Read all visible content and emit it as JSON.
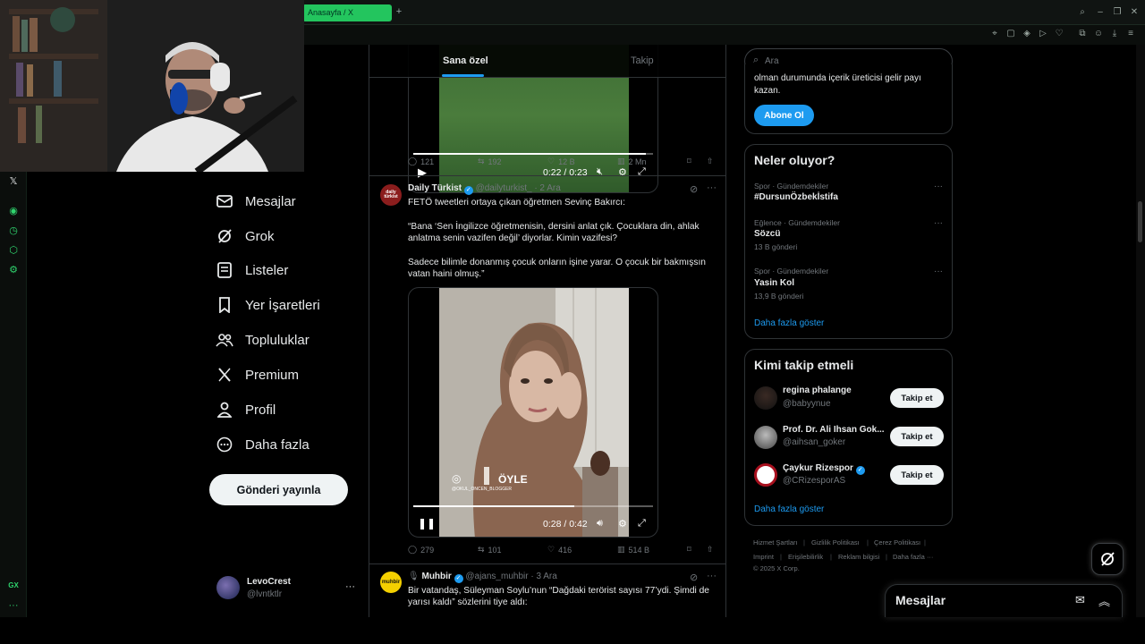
{
  "browser": {
    "tab_title": "Anasayfa / X",
    "new_tab": "+"
  },
  "gx_rail": {
    "bottom_label": "GX",
    "more": "···"
  },
  "nav": {
    "items": [
      {
        "label": "Mesajlar",
        "icon": "mail-icon"
      },
      {
        "label": "Grok",
        "icon": "grok-icon"
      },
      {
        "label": "Listeler",
        "icon": "list-icon"
      },
      {
        "label": "Yer İşaretleri",
        "icon": "bookmark-icon"
      },
      {
        "label": "Topluluklar",
        "icon": "communities-icon"
      },
      {
        "label": "Premium",
        "icon": "x-logo-icon"
      },
      {
        "label": "Profil",
        "icon": "profile-icon"
      },
      {
        "label": "Daha fazla",
        "icon": "more-circle-icon"
      }
    ],
    "post_button": "Gönderi yayınla",
    "account": {
      "name": "LevoCrest",
      "handle": "@lvntktlr",
      "more": "···"
    }
  },
  "timeline": {
    "tabs": [
      "Sana özel",
      "Takip"
    ],
    "tweet1": {
      "video_time": "0:22 / 0:23",
      "replies": "121",
      "reposts": "192",
      "likes": "12 B",
      "views": "2 Mn"
    },
    "tweet2": {
      "name": "Daily Türkist",
      "handle": "@dailyturkist_",
      "time": "· 2 Ara",
      "avatar_text": "daily türkist",
      "text1": "FETÖ tweetleri ortaya çıkan öğretmen Sevinç Bakırcı:",
      "text2": "“Bana ‘Sen İngilizce öğretmenisin, dersini anlat çık. Çocuklara din, ahlak anlatma senin vazifen değil’ diyorlar. Kimin vazifesi?",
      "text3": "Sadece bilimle donanmış çocuk onların işine yarar. O çocuk bir bakmışsın vatan haini olmuş.”",
      "video_caption": "ÖYLE",
      "video_watermark": "@OKUL_ONCEN_BLOGGER",
      "video_time": "0:28 / 0:42",
      "video_progress": 0.67,
      "replies": "279",
      "reposts": "101",
      "likes": "416",
      "views": "514 B"
    },
    "tweet3": {
      "name": "Muhbir",
      "handle": "@ajans_muhbir",
      "time": "· 3 Ara",
      "avatar_text": "muhbir",
      "text": "Bir vatandaş, Süleyman Soylu’nun “Dağdaki terörist sayısı 77’ydi. Şimdi de yarısı kaldı” sözlerini tiye aldı:"
    }
  },
  "right": {
    "search_placeholder": "Ara",
    "premium": {
      "text1": "olman durumunda içerik üreticisi gelir payı",
      "text2": "kazan.",
      "button": "Abone Ol"
    },
    "trends": {
      "title": "Neler oluyor?",
      "items": [
        {
          "category": "Spor · Gündemdekiler",
          "name": "#DursunÖzbekİstifa",
          "count": ""
        },
        {
          "category": "Eğlence · Gündemdekiler",
          "name": "Sözcü",
          "count": "13 B gönderi"
        },
        {
          "category": "Spor · Gündemdekiler",
          "name": "Yasin Kol",
          "count": "13,9 B gönderi"
        }
      ],
      "more": "Daha fazla göster"
    },
    "who_to_follow": {
      "title": "Kimi takip etmeli",
      "users": [
        {
          "name": "regina phalange",
          "handle": "@babyynue",
          "button": "Takip et",
          "verified": false
        },
        {
          "name": "Prof. Dr. Ali Ihsan Gok...",
          "handle": "@aihsan_goker",
          "button": "Takip et",
          "verified": false
        },
        {
          "name": "Çaykur Rizespor",
          "handle": "@CRizesporAS",
          "button": "Takip et",
          "verified": true
        }
      ],
      "more": "Daha fazla göster"
    },
    "footer": {
      "links": [
        "Hizmet Şartları",
        "Gizlilik Politikası",
        "Çerez Politikası",
        "Imprint",
        "Erişilebilirlik",
        "Reklam bilgisi",
        "Daha fazla ···"
      ],
      "copyright": "© 2025 X Corp."
    },
    "messages_drawer": "Mesajlar"
  },
  "colors": {
    "accent": "#1d9bf0",
    "gx_green": "#2fd36d",
    "tab_green": "#23c55e"
  }
}
